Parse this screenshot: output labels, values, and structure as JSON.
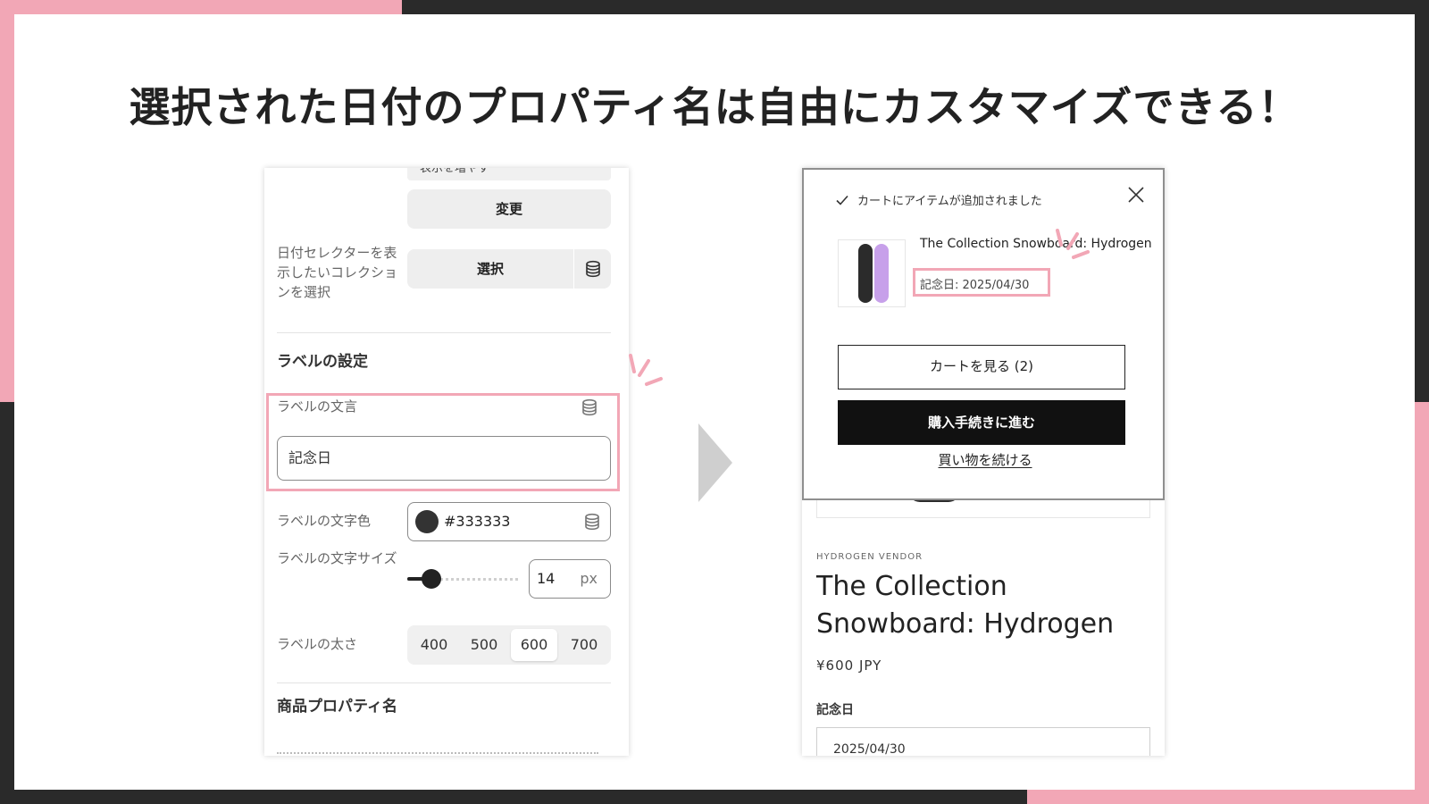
{
  "headline": "選択された日付のプロパティ名は自由にカスタマイズできる！",
  "colors": {
    "accent_pink": "#f2a7b6",
    "frame_dark": "#2a2a2a",
    "label_color": "#333333",
    "swatch_purple": "#c7a0ea"
  },
  "settings_panel": {
    "cut_top_text": "表示を増やす",
    "change_button": "変更",
    "collection_label": "日付セレクターを表示したいコレクションを選択",
    "select_button": "選択",
    "label_section_title": "ラベルの設定",
    "label_text_label": "ラベルの文言",
    "label_text_value": "記念日",
    "label_color_label": "ラベルの文字色",
    "label_color_value": "#333333",
    "label_size_label": "ラベルの文字サイズ",
    "label_size_value": "14",
    "label_size_unit": "px",
    "label_weight_label": "ラベルの太さ",
    "weight_options": [
      "400",
      "500",
      "600",
      "700"
    ],
    "weight_selected": "600",
    "property_section_title": "商品プロパティ名",
    "icons": [
      "database-icon",
      "database-icon",
      "database-icon"
    ]
  },
  "storefront": {
    "popup": {
      "added_message": "カートにアイテムが追加されました",
      "item_name": "The Collection Snowboard: Hydrogen",
      "item_property": "記念日: 2025/04/30",
      "view_cart": "カートを見る (2)",
      "checkout": "購入手続きに進む",
      "continue_shopping": "買い物を続ける",
      "icons": [
        "check-icon",
        "close-icon"
      ]
    },
    "vendor": "HYDROGEN VENDOR",
    "product_title": "The Collection Snowboard: Hydrogen",
    "price": "¥600 JPY",
    "property_label": "記念日",
    "property_value": "2025/04/30"
  }
}
